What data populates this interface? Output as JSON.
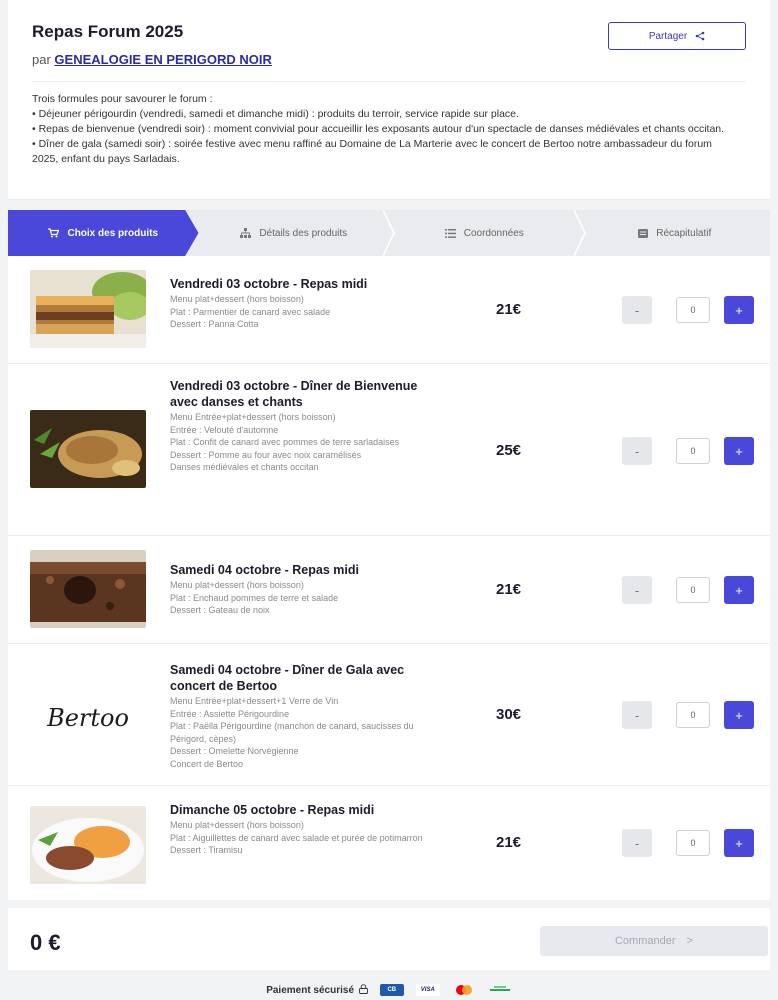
{
  "event": {
    "title": "Repas Forum 2025",
    "by_prefix": "par",
    "organizer": "GENEALOGIE EN PERIGORD NOIR",
    "share_label": "Partager",
    "description": [
      "Trois formules pour savourer le forum :",
      "• Déjeuner périgourdin (vendredi, samedi et dimanche midi) : produits du terroir, service rapide sur place.",
      "• Repas de bienvenue (vendredi soir) : moment convivial pour accueillir les exposants autour d'un spectacle de danses médiévales et chants occitan.",
      "• Dîner de gala (samedi soir) : soirée festive avec menu raffiné au Domaine de La Marterie avec le concert de Bertoo notre ambassadeur du forum 2025, enfant du pays Sarladais."
    ]
  },
  "steps": [
    {
      "label": "Choix des produits",
      "icon": "cart-icon",
      "active": true
    },
    {
      "label": "Détails des produits",
      "icon": "sitemap-icon",
      "active": false
    },
    {
      "label": "Coordonnées",
      "icon": "list-icon",
      "active": false
    },
    {
      "label": "Récapitulatif",
      "icon": "receipt-icon",
      "active": false
    }
  ],
  "products": [
    {
      "name": "Vendredi 03 octobre - Repas midi",
      "details": [
        "Menu plat+dessert (hors boisson)",
        "Plat : Parmentier de canard avec salade",
        "Dessert : Panna Cotta"
      ],
      "price": "21€",
      "quantity": "0",
      "image": "parmentier-photo"
    },
    {
      "name": "Vendredi 03 octobre - Dîner de Bienvenue avec danses et chants",
      "details": [
        "Menu Entrée+plat+dessert (hors boisson)",
        "Entrée : Velouté d'automne",
        "Plat : Confit de canard avec pommes de terre sarladaises",
        "Dessert : Pomme au four avec noix caramélisés",
        "Danses médiévales et chants occitan"
      ],
      "price": "25€",
      "quantity": "0",
      "image": "confit-photo"
    },
    {
      "name": "Samedi 04 octobre - Repas midi",
      "details": [
        "Menu plat+dessert (hors boisson)",
        "Plat : Enchaud pommes de terre et salade",
        "Dessert : Gateau de noix"
      ],
      "price": "21€",
      "quantity": "0",
      "image": "gateau-photo"
    },
    {
      "name": "Samedi 04 octobre - Dîner de Gala avec concert de Bertoo",
      "details": [
        "Menu Entrée+plat+dessert+1 Verre de Vin",
        "Entrée : Assiette Périgourdine",
        "Plat : Paëlla Périgourdine (manchon de canard, saucisses du Périgord, cèpes)",
        "Dessert : Omelette Norvégienne",
        "Concert de Bertoo"
      ],
      "price": "30€",
      "quantity": "0",
      "image": "bertoo-signature",
      "signature": "Bertoo"
    },
    {
      "name": "Dimanche 05 octobre - Repas midi",
      "details": [
        "Menu plat+dessert (hors boisson)",
        "Plat : Aiguillettes de canard avec salade et purée de potimarron",
        "Dessert : Tiramisu"
      ],
      "price": "21€",
      "quantity": "0",
      "image": "aiguillettes-photo"
    }
  ],
  "qty_controls": {
    "minus": "-",
    "plus": "+"
  },
  "footer": {
    "total": "0 €",
    "order_label": "Commander",
    "order_chevron": ">",
    "secure_label": "Paiement sécurisé",
    "payment_methods": [
      "CB",
      "VISA",
      "Mastercard",
      "Paysafe"
    ]
  },
  "colors": {
    "accent": "#4a48d8",
    "link": "#2b2ba8"
  }
}
